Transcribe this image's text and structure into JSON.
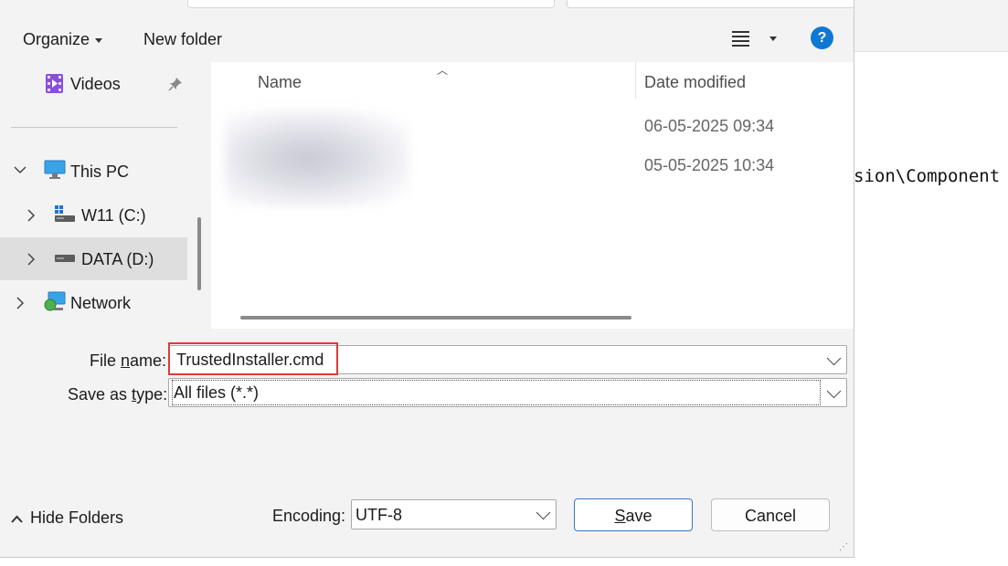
{
  "background_editor": {
    "code_text": "sion\\Component"
  },
  "toolbar": {
    "organize_label": "Organize",
    "new_folder_label": "New folder",
    "help_label": "?"
  },
  "nav": {
    "items": [
      {
        "label": "Videos",
        "icon": "videos-icon"
      },
      {
        "label": "This PC",
        "icon": "this-pc-icon"
      },
      {
        "label": "W11 (C:)",
        "icon": "drive-c-icon"
      },
      {
        "label": "DATA (D:)",
        "icon": "drive-d-icon",
        "selected": true
      },
      {
        "label": "Network",
        "icon": "network-icon"
      }
    ]
  },
  "filelist": {
    "columns": {
      "name": "Name",
      "date": "Date modified"
    },
    "rows": [
      {
        "date": "06-05-2025 09:34"
      },
      {
        "date": "05-05-2025 10:34"
      }
    ]
  },
  "form": {
    "file_name_label_pre": "File ",
    "file_name_label_ul": "n",
    "file_name_label_post": "ame:",
    "file_name_value": "TrustedInstaller.cmd",
    "save_type_label_pre": "Save as ",
    "save_type_label_ul": "t",
    "save_type_label_post": "ype:",
    "save_type_value": "All files  (*.*)"
  },
  "bottom": {
    "hide_folders_label": "Hide Folders",
    "encoding_label": "Encoding:",
    "encoding_value": "UTF-8",
    "save_label_ul": "S",
    "save_label_rest": "ave",
    "cancel_label": "Cancel"
  },
  "colors": {
    "accent": "#0f78d4",
    "highlight_box": "#e03a3a"
  }
}
